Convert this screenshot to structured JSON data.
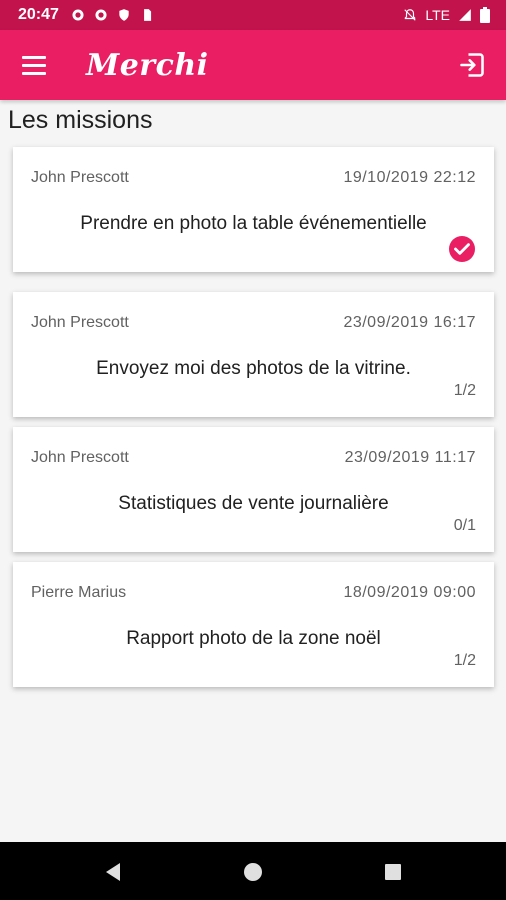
{
  "status_bar": {
    "time": "20:47",
    "network": "LTE"
  },
  "app_bar": {
    "title": "Merchi"
  },
  "section_title": "Les missions",
  "missions": [
    {
      "author": "John Prescott",
      "date": "19/10/2019 22:12",
      "title": "Prendre en photo la table événementielle",
      "progress": "",
      "completed": true
    },
    {
      "author": "John Prescott",
      "date": "23/09/2019 16:17",
      "title": "Envoyez moi des photos de la vitrine.",
      "progress": "1/2",
      "completed": false
    },
    {
      "author": "John Prescott",
      "date": "23/09/2019 11:17",
      "title": "Statistiques de vente journalière",
      "progress": "0/1",
      "completed": false
    },
    {
      "author": "Pierre Marius",
      "date": "18/09/2019 09:00",
      "title": "Rapport photo de la zone noël",
      "progress": "1/2",
      "completed": false
    }
  ],
  "colors": {
    "primary": "#e91e63",
    "primary_dark": "#c2134d"
  },
  "icons": [
    "settings-icon",
    "settings-icon",
    "shield-icon",
    "sim-card-icon",
    "muted-icon",
    "signal-icon",
    "battery-icon",
    "menu-icon",
    "logout-icon",
    "check-circle-icon",
    "back-icon",
    "home-icon",
    "recents-icon"
  ]
}
